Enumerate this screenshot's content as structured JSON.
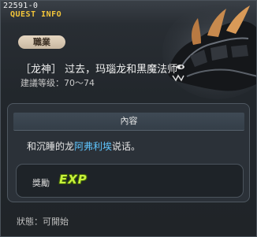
{
  "window": {
    "quest_id": "22591-0",
    "title": "QUEST INFO"
  },
  "job": {
    "label": "職業",
    "npc_line": "［龙神］ 过去，玛瑙龙和黑魔法师",
    "level_text": "建議等级：70～74"
  },
  "content": {
    "header": "內容",
    "desc_before": "和沉睡的龙",
    "desc_highlight": "阿弗利埃",
    "desc_after": "说话。",
    "highlight_color": "#5fc6ff"
  },
  "reward": {
    "label": "獎勵",
    "exp_text": "EXP"
  },
  "status": {
    "text": "狀態：可開始"
  },
  "icons": [
    "dragon-portrait-icon",
    "exp-icon"
  ]
}
